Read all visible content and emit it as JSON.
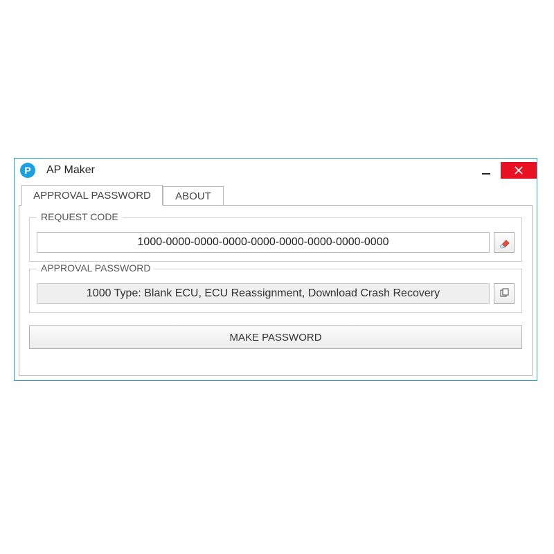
{
  "window": {
    "title": "AP Maker",
    "icon_letter": "P"
  },
  "tabs": [
    {
      "label": "APPROVAL PASSWORD",
      "active": true
    },
    {
      "label": "ABOUT",
      "active": false
    }
  ],
  "groups": {
    "request": {
      "legend": "REQUEST CODE",
      "value": "1000-0000-0000-0000-0000-0000-0000-0000-0000",
      "clear_icon": "eraser-icon"
    },
    "approval": {
      "legend": "APPROVAL PASSWORD",
      "value": "1000 Type: Blank ECU, ECU Reassignment, Download Crash Recovery",
      "copy_icon": "copy-icon"
    }
  },
  "buttons": {
    "make_password": "MAKE PASSWORD"
  }
}
